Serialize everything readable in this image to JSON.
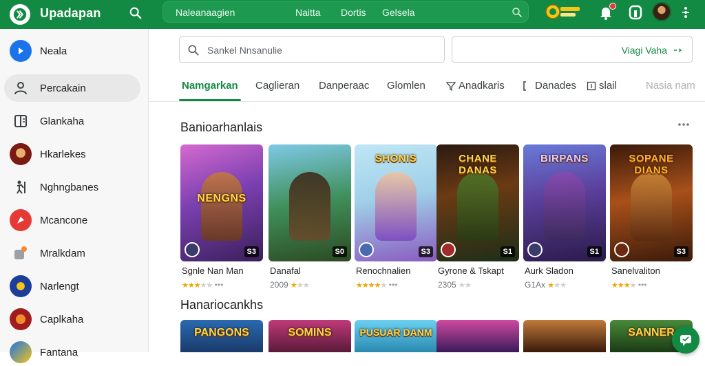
{
  "app": {
    "brand": "Upadapan",
    "accent_color": "#138a43"
  },
  "topbar": {
    "search_placeholder": "Naleanaagien",
    "nav": [
      "Naitta",
      "Dortis",
      "Gelsela"
    ],
    "badge_logo_icon": "game-badge-logo",
    "icons": [
      "search-icon",
      "bell-icon",
      "profile-letter-icon",
      "avatar",
      "more-vert-icon"
    ]
  },
  "sidebar": {
    "items": [
      {
        "label": "Neala",
        "icon": "play-circle-icon"
      },
      {
        "label": "Percakain",
        "icon": "person-icon"
      },
      {
        "label": "Glankaha",
        "icon": "book-icon"
      },
      {
        "label": "Hkarlekes",
        "icon": "game-avatar-icon"
      },
      {
        "label": "Nghngbanes",
        "icon": "figure-icon"
      },
      {
        "label": "Mcancone",
        "icon": "red-badge-icon"
      },
      {
        "label": "Mralkdam",
        "icon": "puzzle-icon"
      },
      {
        "label": "Narlengt",
        "icon": "blue-shield-icon"
      },
      {
        "label": "Caplkaha",
        "icon": "red-game-icon"
      },
      {
        "label": "Fantana",
        "icon": "blue-game-icon"
      }
    ]
  },
  "main": {
    "search_placeholder": "Sankel Nnsanulie",
    "filter_value": "Viagi Vaha",
    "tabs": [
      {
        "label": "Namgarkan",
        "active": true
      },
      {
        "label": "Caglieran"
      },
      {
        "label": "Danperaac"
      },
      {
        "label": "Glomlen"
      },
      {
        "label": "Anadkaris"
      },
      {
        "label": "Danades"
      },
      {
        "label": "slail"
      },
      {
        "label": "Nasia nam"
      }
    ],
    "section1_title": "Banioarhanlais",
    "section2_title": "Hanariocankhs",
    "cards": [
      {
        "art_title": "NENGNS",
        "name": "Sgnle Nan Man",
        "meta": "",
        "rating": 2.5,
        "score": "S3"
      },
      {
        "art_title": "",
        "name": "Danafal",
        "meta": "2009",
        "rating": 1.5,
        "score": "S0"
      },
      {
        "art_title": "SHONIS",
        "name": "Renochnalien",
        "meta": "",
        "rating": 4,
        "score": "S3"
      },
      {
        "art_title": "CHANE DANAS",
        "name": "Gyrone & Tskapt",
        "meta": "2305",
        "rating": 2,
        "score": "S1"
      },
      {
        "art_title": "BIRPANS",
        "name": "Aurk Sladon",
        "meta": "G1Ax",
        "rating": 1,
        "score": "S1"
      },
      {
        "art_title": "SOPANE DIANS",
        "name": "Sanelvaliton",
        "meta": "",
        "rating": 2.5,
        "score": "S3"
      }
    ],
    "cards2": [
      {
        "art_title": "PANGONS"
      },
      {
        "art_title": "SOMINS"
      },
      {
        "art_title": "PUSUAR DANM"
      },
      {
        "art_title": ""
      },
      {
        "art_title": ""
      },
      {
        "art_title": "SANNER"
      }
    ]
  }
}
